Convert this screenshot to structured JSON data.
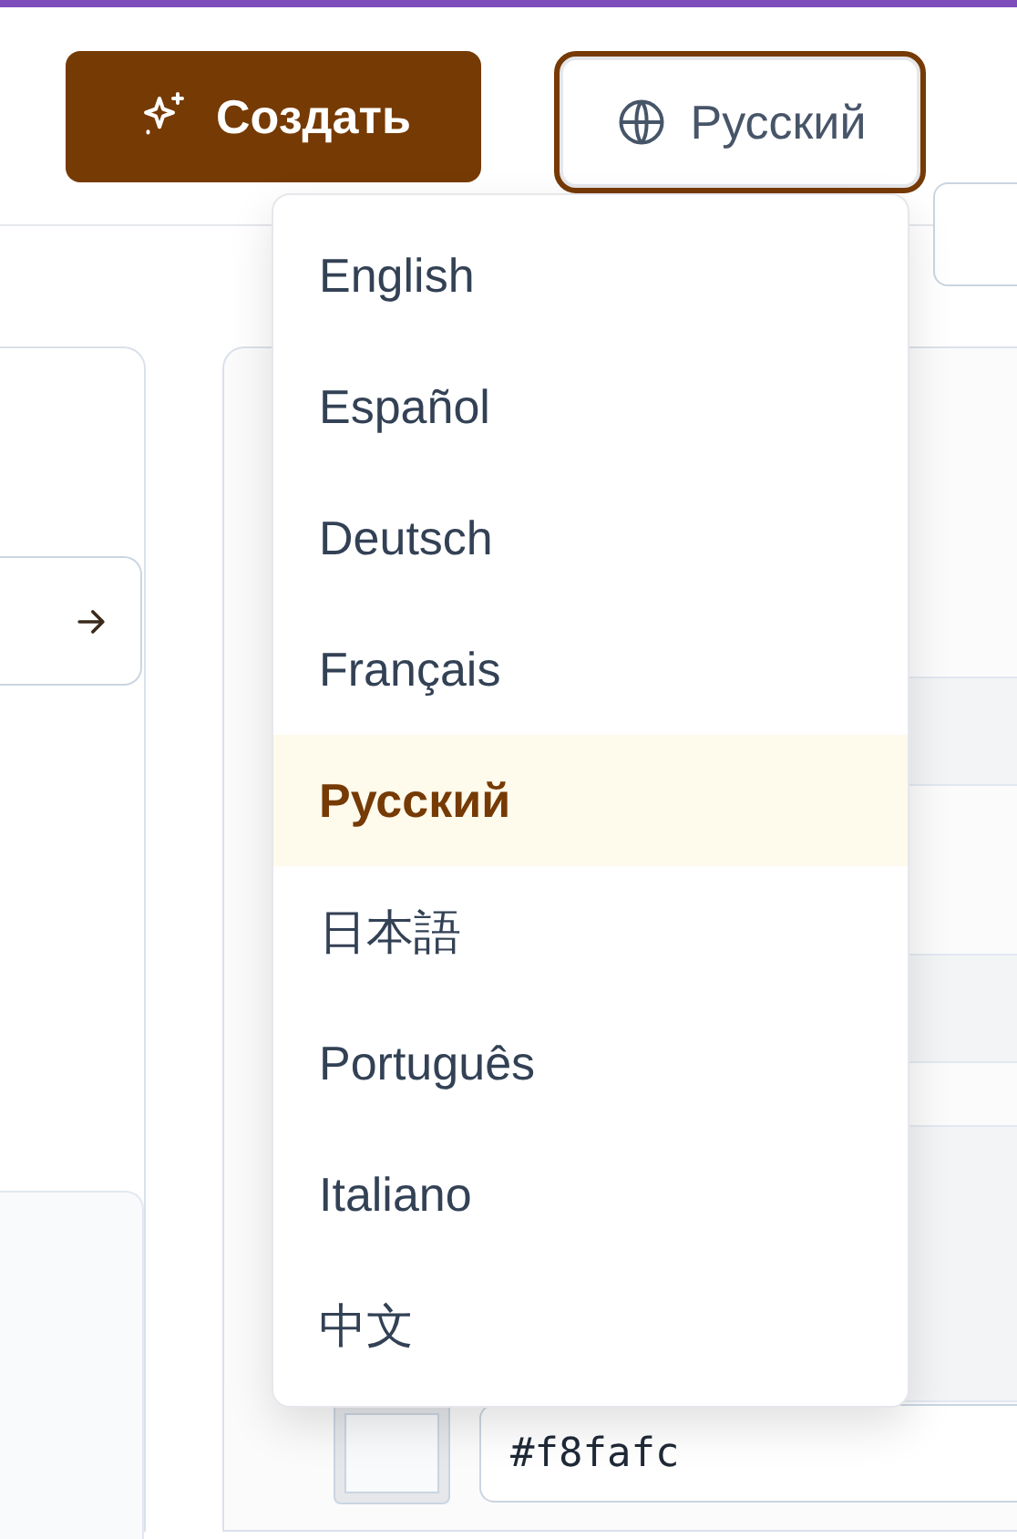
{
  "header": {
    "create_button": {
      "label": "Создать"
    },
    "language_button": {
      "label": "Русский",
      "expanded": true
    }
  },
  "language_menu": [
    {
      "label": "English",
      "selected": false
    },
    {
      "label": "Español",
      "selected": false
    },
    {
      "label": "Deutsch",
      "selected": false
    },
    {
      "label": "Français",
      "selected": false
    },
    {
      "label": "Русский",
      "selected": true
    },
    {
      "label": "日本語",
      "selected": false
    },
    {
      "label": "Português",
      "selected": false
    },
    {
      "label": "Italiano",
      "selected": false
    },
    {
      "label": "中文",
      "selected": false
    }
  ],
  "color_field": {
    "value": "#f8fafc"
  }
}
